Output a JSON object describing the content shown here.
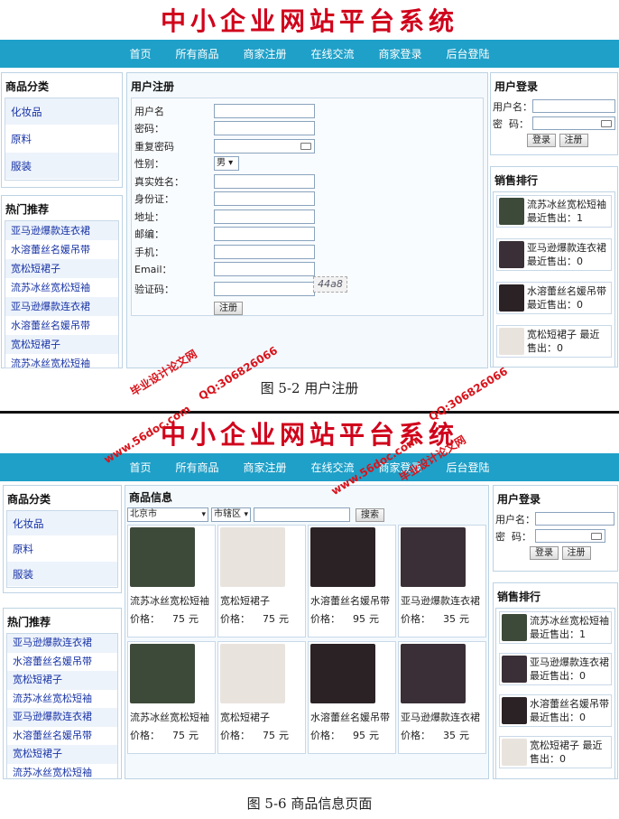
{
  "site_title": "中小企业网站平台系统",
  "nav": [
    "首页",
    "所有商品",
    "商家注册",
    "在线交流",
    "商家登录",
    "后台登陆"
  ],
  "category": {
    "title": "商品分类",
    "items": [
      "化妆品",
      "原料",
      "服装"
    ]
  },
  "hot": {
    "title": "热门推荐",
    "items_a": [
      "亚马逊爆款连衣裙",
      "水溶蕾丝名媛吊带",
      "宽松短裙子",
      "流苏冰丝宽松短袖",
      "亚马逊爆款连衣裙",
      "水溶蕾丝名媛吊带",
      "宽松短裙子",
      "流苏冰丝宽松短袖"
    ],
    "items_b": [
      "亚马逊爆款连衣裙",
      "水溶蕾丝名媛吊带",
      "宽松短裙子",
      "流苏冰丝宽松短袖",
      "亚马逊爆款连衣裙",
      "水溶蕾丝名媛吊带",
      "宽松短裙子",
      "流苏冰丝宽松短袖"
    ]
  },
  "register": {
    "title": "用户注册",
    "labels": {
      "username": "用户名",
      "password": "密码：",
      "confirm": "重复密码",
      "gender": "性别：",
      "realname": "真实姓名：",
      "idcard": "身份证：",
      "address": "地址：",
      "postcode": "邮编：",
      "phone": "手机：",
      "email": "Email：",
      "captcha": "验证码："
    },
    "gender_value": "男",
    "captcha_code": "44a8",
    "submit": "注册"
  },
  "login": {
    "title": "用户登录",
    "username_label": "用户名：",
    "password_label": "密  码：",
    "login_btn": "登录",
    "register_btn": "注册"
  },
  "ranking": {
    "title": "销售排行",
    "items": [
      {
        "name": "流苏冰丝宽松短袖",
        "sold": "最近售出：1"
      },
      {
        "name": "亚马逊爆款连衣裙",
        "sold": "最近售出：0"
      },
      {
        "name": "水溶蕾丝名媛吊带",
        "sold": "最近售出：0"
      },
      {
        "name": "宽松短裙子",
        "sold": "最近售出：0"
      }
    ]
  },
  "goods": {
    "title": "商品信息",
    "city": "北京市",
    "district": "市辖区",
    "search_btn": "搜索",
    "price_label": "价格：",
    "unit": "元",
    "items": [
      {
        "name": "流苏冰丝宽松短袖",
        "price": "75"
      },
      {
        "name": "宽松短裙子",
        "price": "75"
      },
      {
        "name": "水溶蕾丝名媛吊带",
        "price": "95"
      },
      {
        "name": "亚马逊爆款连衣裙",
        "price": "35"
      },
      {
        "name": "流苏冰丝宽松短袖",
        "price": "75"
      },
      {
        "name": "宽松短裙子",
        "price": "75"
      },
      {
        "name": "水溶蕾丝名媛吊带",
        "price": "95"
      },
      {
        "name": "亚马逊爆款连衣裙",
        "price": "35"
      }
    ]
  },
  "captions": [
    "图 5-2 用户注册",
    "图 5-6 商品信息页面"
  ],
  "watermarks": [
    "毕业设计论文网",
    "QQ:306826066",
    "www.56doc.com"
  ],
  "colors": {
    "nav_bg": "#1fa0c8",
    "title_red": "#d0021b",
    "link_blue": "#1733a6"
  },
  "thumb_colors": [
    "#3d4a3a",
    "#e9e3de",
    "#2b2226",
    "#3a2f36"
  ]
}
